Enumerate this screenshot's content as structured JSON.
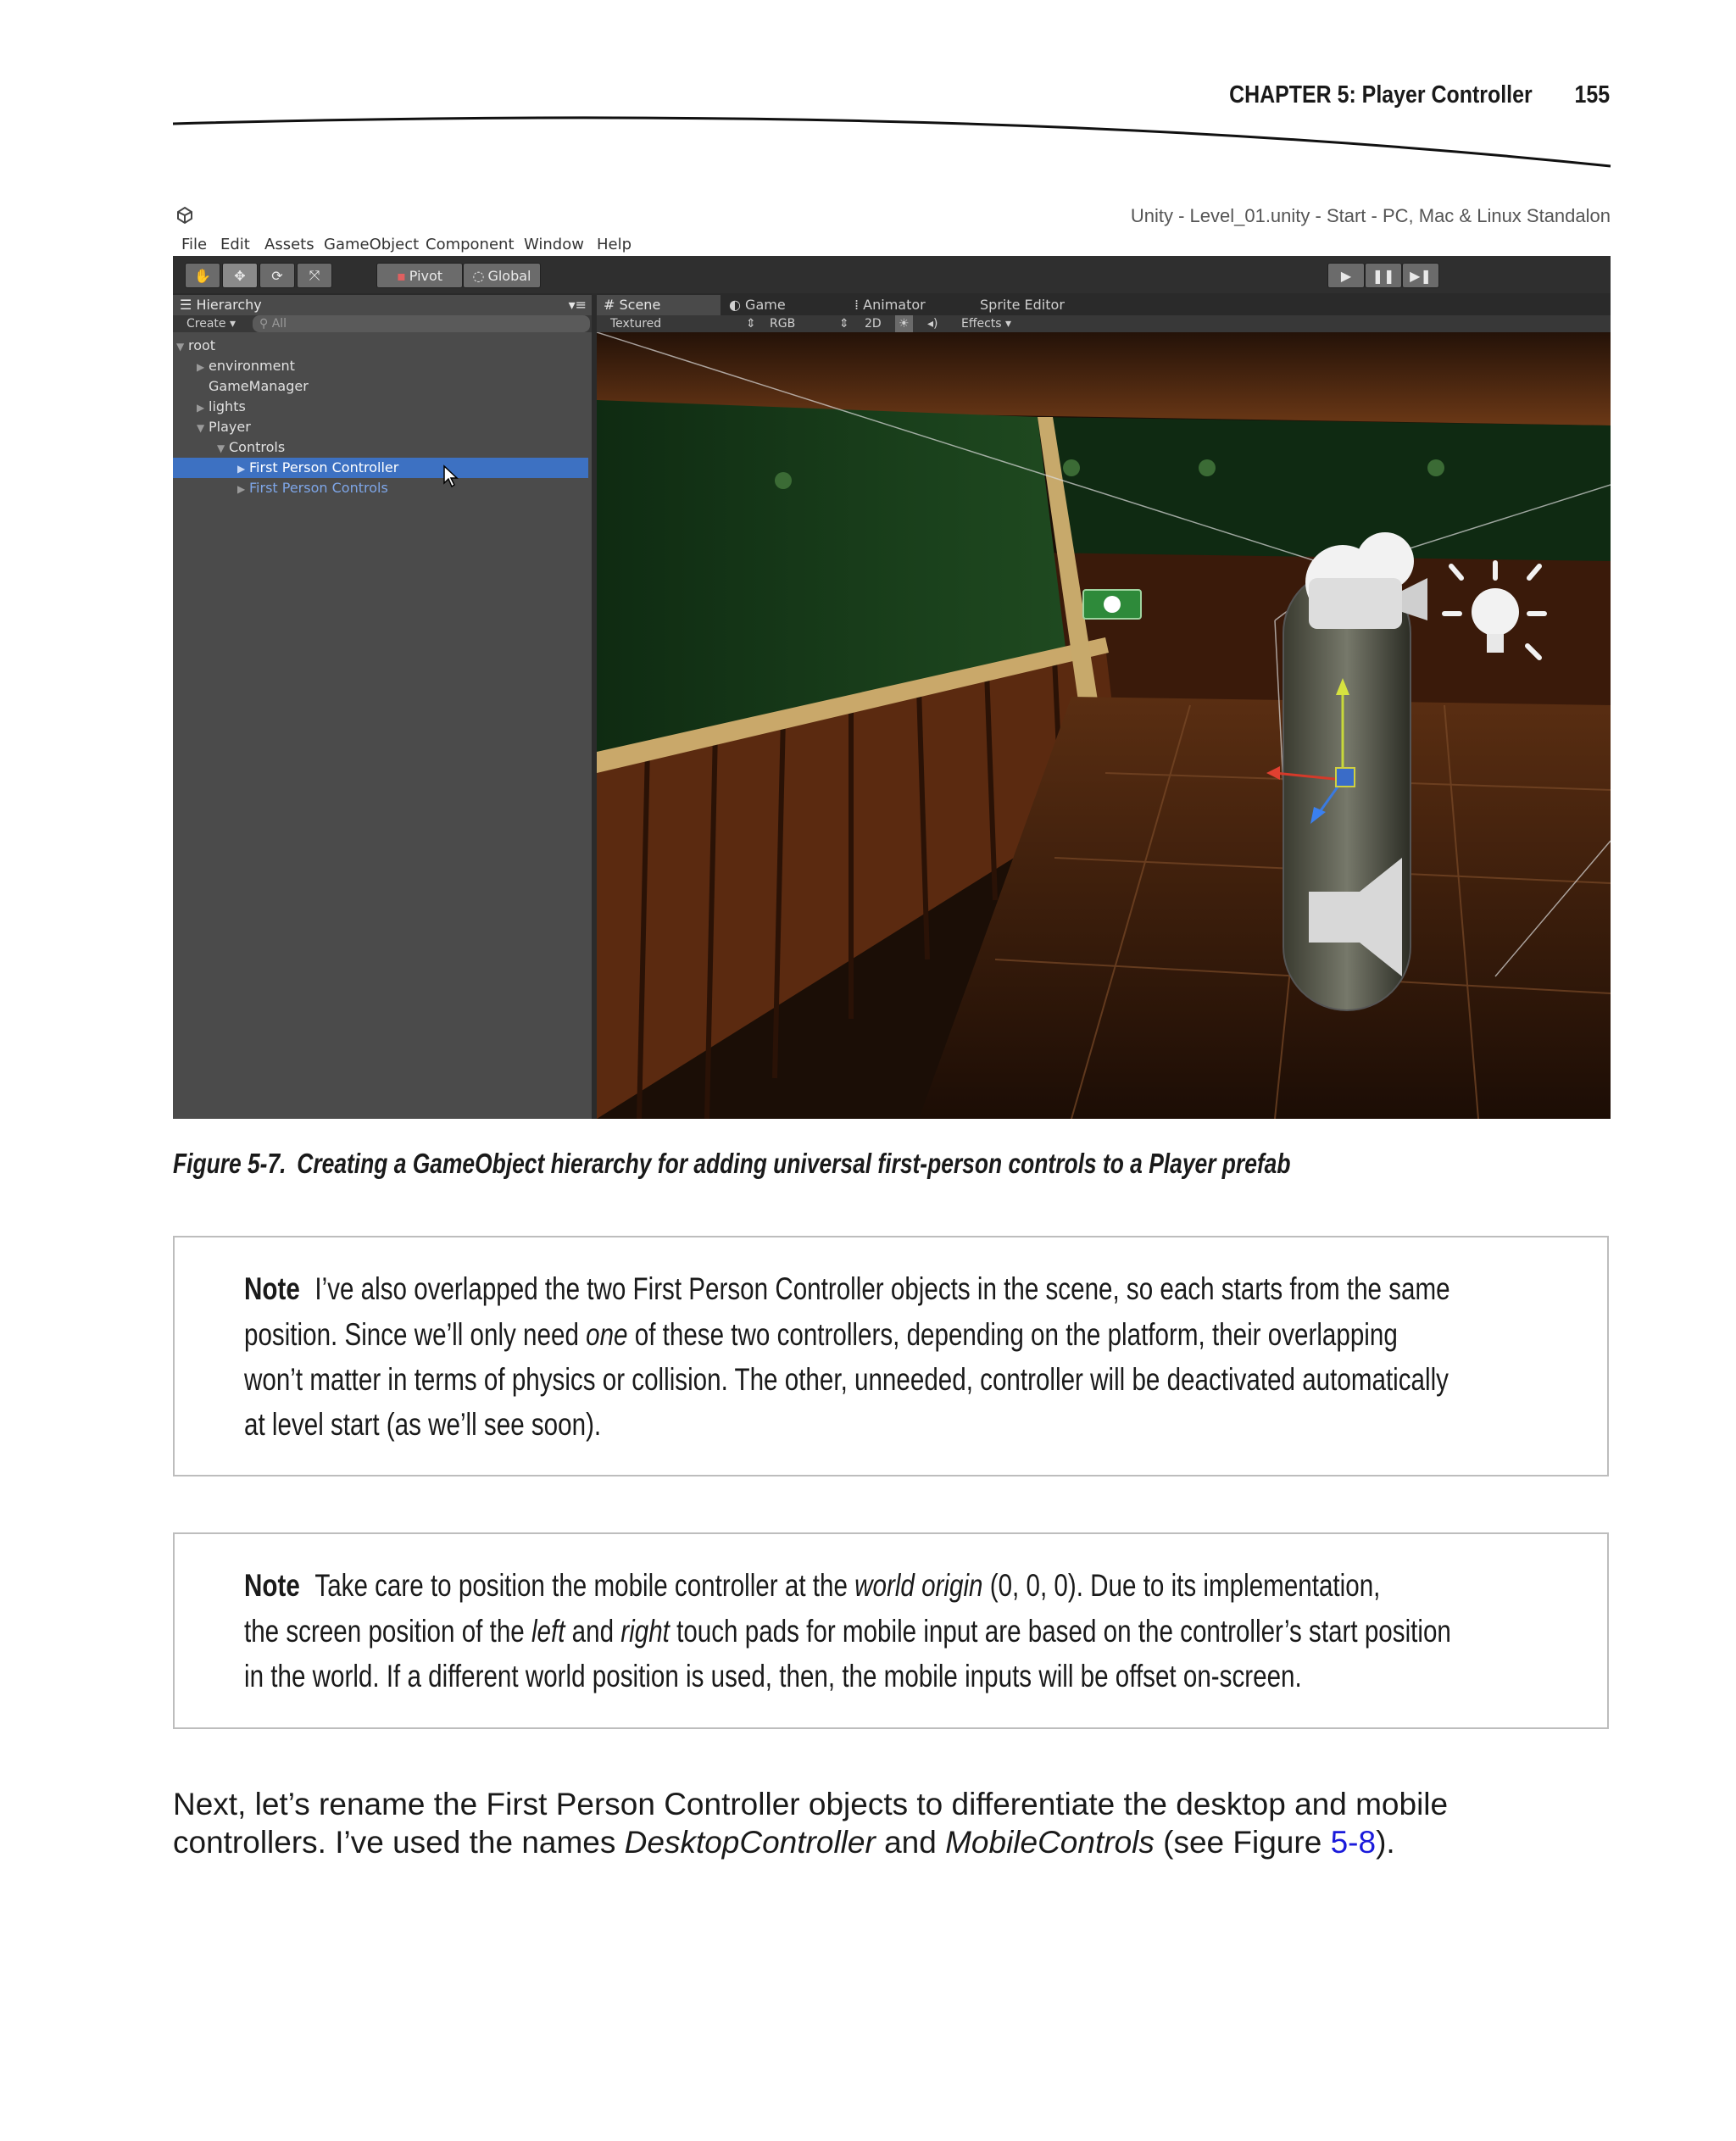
{
  "header": {
    "chapter": "CHAPTER 5: Player Controller",
    "page_number": "155"
  },
  "screenshot": {
    "window_title": "Unity - Level_01.unity - Start - PC, Mac & Linux Standalon",
    "menu": [
      "File",
      "Edit",
      "Assets",
      "GameObject",
      "Component",
      "Window",
      "Help"
    ],
    "toolbar": {
      "pivot": "Pivot",
      "global": "Global"
    },
    "tabs": {
      "hierarchy": "Hierarchy",
      "scene": "Scene",
      "game": "Game",
      "animator": "Animator",
      "sprite_editor": "Sprite Editor"
    },
    "hierarchy_bar": {
      "create": "Create",
      "search_placeholder": "All"
    },
    "scene_bar": {
      "shading": "Textured",
      "channel": "RGB",
      "mode_2d": "2D",
      "effects": "Effects"
    },
    "hierarchy_items": [
      {
        "label": "root"
      },
      {
        "label": "environment"
      },
      {
        "label": "GameManager"
      },
      {
        "label": "lights"
      },
      {
        "label": "Player"
      },
      {
        "label": "Controls"
      },
      {
        "label": "First Person Controller"
      },
      {
        "label": "First Person Controls"
      }
    ],
    "selected_item": "First Person Controller"
  },
  "caption": {
    "label": "Figure 5-7.",
    "text": "Creating a GameObject hierarchy for adding universal first-person controls to a Player prefab"
  },
  "note1": {
    "keyword": "Note",
    "line1": "I’ve also overlapped the two First Person Controller objects in the scene, so each starts from the same",
    "line2_a": "position. Since we’ll only need ",
    "line2_em": "one",
    "line2_b": " of these two controllers, depending on the platform, their overlapping",
    "line3": "won’t matter in terms of physics or collision. The other, unneeded, controller will be deactivated automatically",
    "line4": "at level start (as we’ll see soon)."
  },
  "note2": {
    "keyword": "Note",
    "line1_a": "Take care to position the mobile controller at the ",
    "line1_em": "world origin",
    "line1_b": " (0, 0, 0). Due to its implementation,",
    "line2_a": "the screen position of the ",
    "line2_em1": "left",
    "line2_mid": " and ",
    "line2_em2": "right",
    "line2_b": " touch pads for mobile input are based on the controller’s start position",
    "line3": "in the world. If a different world position is used, then, the mobile inputs will be offset on-screen."
  },
  "body": {
    "line1": "Next, let’s rename the First Person Controller objects to differentiate the desktop and mobile",
    "line2_a": "controllers. I’ve used the names ",
    "line2_em1": "DesktopController",
    "line2_mid": " and ",
    "line2_em2": "MobileControls",
    "line2_b": " (see Figure ",
    "line2_link": "5-8",
    "line2_c": ")."
  }
}
